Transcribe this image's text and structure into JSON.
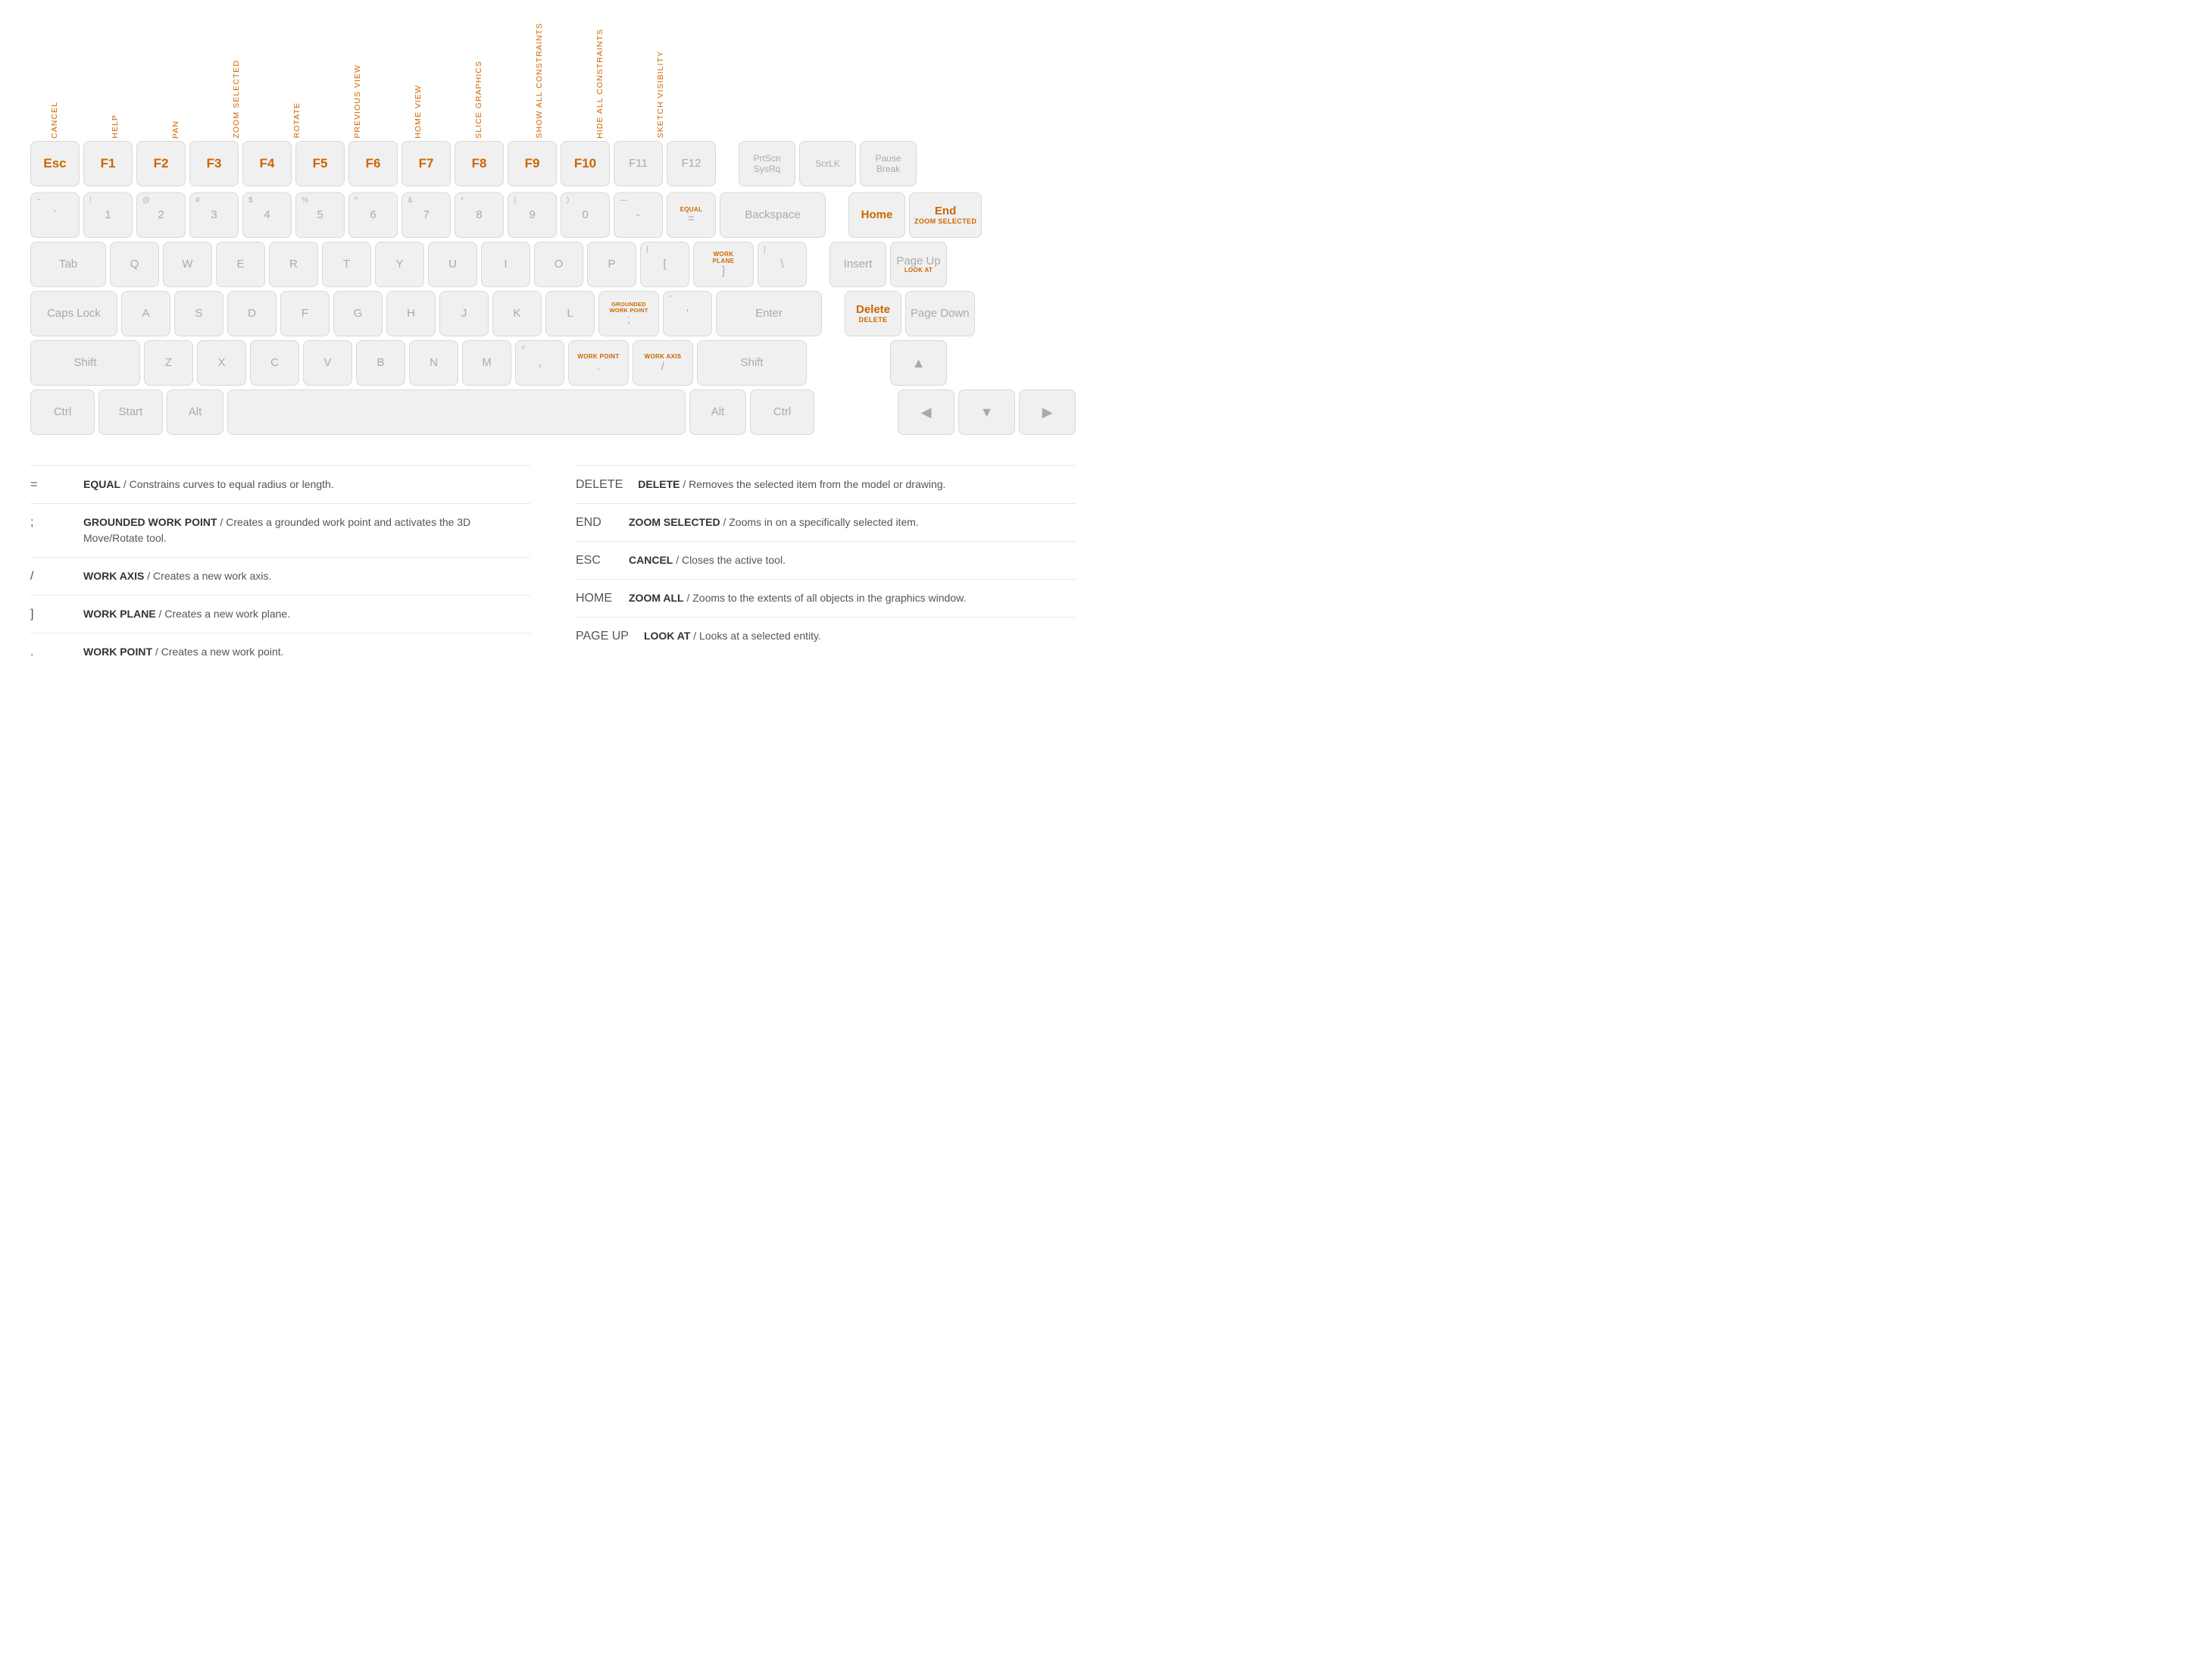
{
  "keyboard": {
    "fkey_labels": [
      {
        "key": "Esc",
        "label": "CANCEL",
        "orange": true
      },
      {
        "key": "F1",
        "label": "HELP",
        "orange": true
      },
      {
        "key": "F2",
        "label": "PAN",
        "orange": true
      },
      {
        "key": "F3",
        "label": "ZOOM SELECTED",
        "orange": true
      },
      {
        "key": "F4",
        "label": "ROTATE",
        "orange": true
      },
      {
        "key": "F5",
        "label": "PREVIOUS VIEW",
        "orange": true
      },
      {
        "key": "F6",
        "label": "HOME VIEW",
        "orange": true
      },
      {
        "key": "F7",
        "label": "SLICE GRAPHICS",
        "orange": true
      },
      {
        "key": "F8",
        "label": "SHOW ALL CONSTRAINTS",
        "orange": true
      },
      {
        "key": "F9",
        "label": "HIDE ALL CONSTRAINTS",
        "orange": true
      },
      {
        "key": "F10",
        "label": "SKETCH VISIBILITY",
        "orange": true
      }
    ],
    "rows": {
      "function_row": [
        "Esc",
        "F1",
        "F2",
        "F3",
        "F4",
        "F5",
        "F6",
        "F7",
        "F8",
        "F9",
        "F10",
        "F11",
        "F12",
        "PrtScn SysRq",
        "ScrLK",
        "Pause Break"
      ],
      "number_row": [
        "~`",
        "!1",
        "@2",
        "#3",
        "$4",
        "%5",
        "^6",
        "&7",
        "*8",
        "(9",
        ")0",
        "—-",
        "=",
        "Backspace"
      ],
      "tab_row": [
        "Tab",
        "Q",
        "W",
        "E",
        "R",
        "T",
        "Y",
        "U",
        "I",
        "O",
        "P",
        "[",
        "WORK PLANE ]",
        "\\"
      ],
      "caps_row": [
        "Caps Lock",
        "A",
        "S",
        "D",
        "F",
        "G",
        "H",
        "J",
        "K",
        "L",
        "GROUNDED WORK POINT ;",
        "\"'",
        "Enter"
      ],
      "shift_row": [
        "Shift",
        "Z",
        "X",
        "C",
        "V",
        "B",
        "N",
        "M",
        "<,",
        "WORK POINT .",
        "WORK AXIS /",
        "Shift"
      ],
      "ctrl_row": [
        "Ctrl",
        "Start",
        "Alt",
        "Space",
        "Alt",
        "Ctrl"
      ]
    }
  },
  "legend": {
    "col1": [
      {
        "key": "=",
        "title": "EQUAL",
        "desc": "Constrains curves to equal radius or length."
      },
      {
        "key": ";",
        "title": "GROUNDED WORK POINT",
        "desc": "Creates a grounded work point and activates the 3D Move/Rotate tool."
      },
      {
        "key": "/",
        "title": "WORK AXIS",
        "desc": "Creates a new work axis."
      },
      {
        "key": "]",
        "title": "WORK PLANE",
        "desc": "Creates a new work plane."
      },
      {
        "key": ".",
        "title": "WORK POINT",
        "desc": "Creates a new work point."
      }
    ],
    "col2": [
      {
        "key": "DELETE",
        "title": "DELETE",
        "desc": "Removes the selected item from the model or drawing."
      },
      {
        "key": "END",
        "title": "ZOOM SELECTED",
        "desc": "Zooms in on a specifically selected item."
      },
      {
        "key": "ESC",
        "title": "CANCEL",
        "desc": "Closes the active tool."
      },
      {
        "key": "HOME",
        "title": "ZOOM ALL",
        "desc": "Zooms to the extents of all objects in the graphics window."
      },
      {
        "key": "PAGE UP",
        "title": "LOOK AT",
        "desc": "Looks at a selected entity."
      }
    ]
  }
}
